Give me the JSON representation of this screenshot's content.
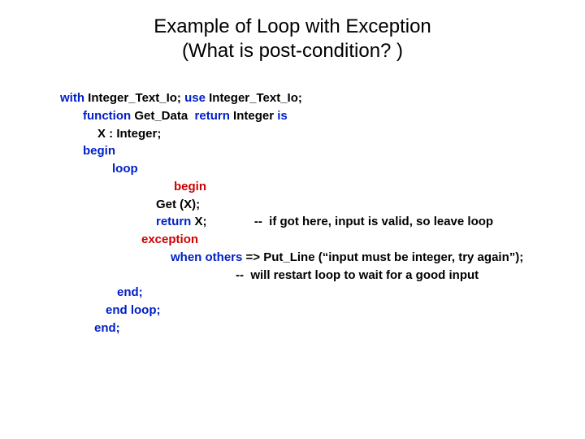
{
  "title_line1": "Example of Loop with Exception",
  "title_line2": "(What is post-condition? )",
  "code": {
    "l0_kw1": "with ",
    "l0_id1": "Integer_Text_Io; ",
    "l0_kw2": "use ",
    "l0_id2": "Integer_Text_Io;",
    "l1_kw1": "function ",
    "l1_id1": "Get_Data  ",
    "l1_kw2": "return ",
    "l1_id2": "Integer ",
    "l1_kw3": "is",
    "l2": "X : Integer;",
    "l3": "begin",
    "l4": "loop",
    "l5": "begin",
    "l6": "Get (X);",
    "l7_kw": "return ",
    "l7_id": "X;",
    "l7_cmt": "              --  if got here, input is valid, so leave loop",
    "l8": "exception",
    "l9_kw": "when others ",
    "l9_id": "=> Put_Line (“input must be integer, try again”);",
    "l10": "--  will restart loop to wait for a good input",
    "l11": "end;",
    "l12": "end loop;",
    "l13": "end;"
  }
}
